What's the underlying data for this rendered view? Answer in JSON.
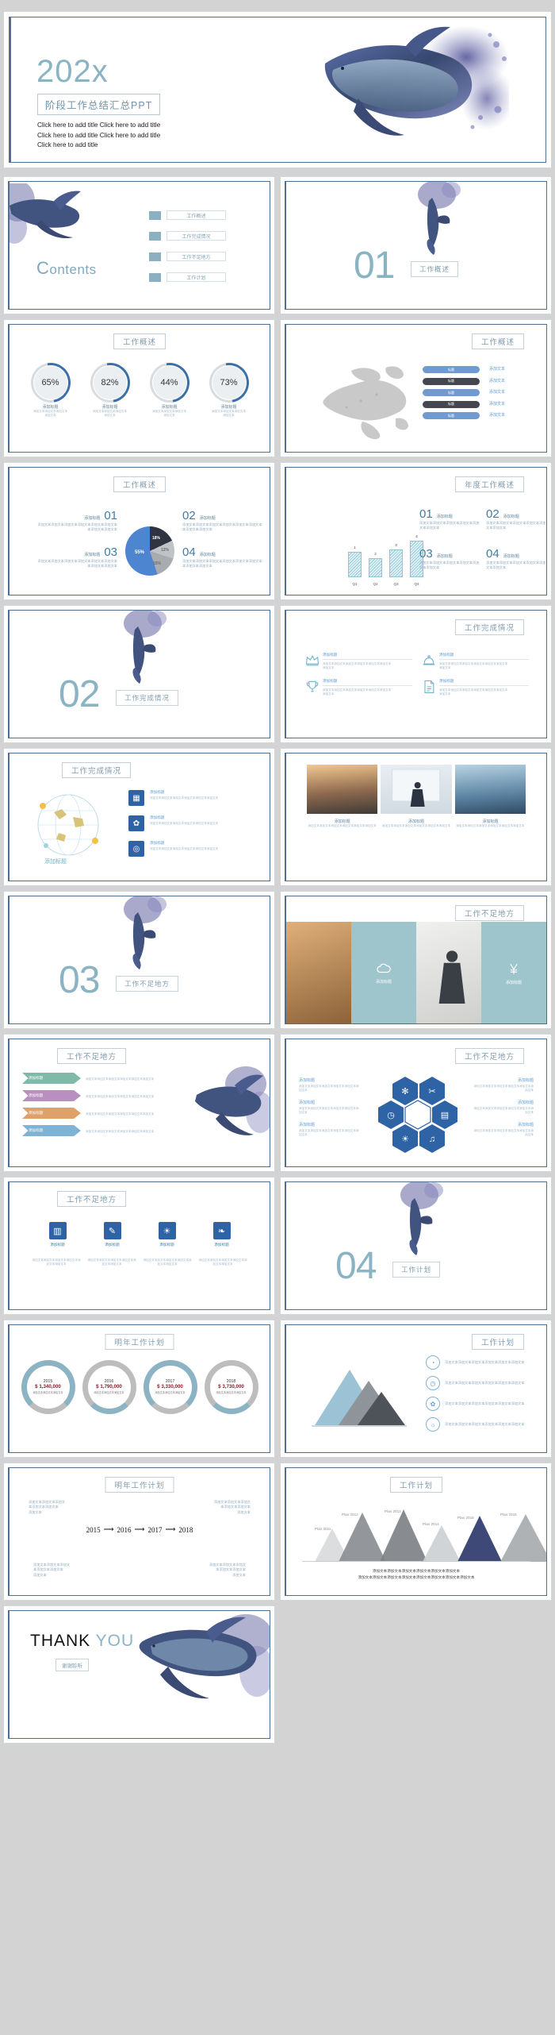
{
  "hero": {
    "year": "202x",
    "subtitle": "阶段工作总结汇总PPT",
    "line1": "Click here to add title Click here to add title",
    "line2": "Click here to add title Click here to add title",
    "line3": "Click here to add title"
  },
  "section_titles": {
    "overview": "工作概述",
    "annual_overview": "年度工作概述",
    "completion": "工作完成情况",
    "shortcomings": "工作不足地方",
    "plan": "工作计划",
    "next_year_plan": "明年工作计划",
    "thanks": "谢谢聆听"
  },
  "contents": {
    "heading_cap": "C",
    "heading_rest": "ontents",
    "items": [
      {
        "label": "工作概述"
      },
      {
        "label": "工作完成情况"
      },
      {
        "label": "工作不足地方"
      },
      {
        "label": "工作计划"
      }
    ]
  },
  "sections": [
    {
      "number": "01",
      "label": "工作概述"
    },
    {
      "number": "02",
      "label": "工作完成情况"
    },
    {
      "number": "03",
      "label": "工作不足地方"
    },
    {
      "number": "04",
      "label": "工作计划"
    }
  ],
  "placeholders": {
    "title": "添加标题",
    "text": "添加文本",
    "body_short": "添加文本添加文本添加文本",
    "body_long": "添加文本添加文本添加文本添加文本添加文本添加文本",
    "body_mid": "添加文本添加文本添加文",
    "body_tail": "本添加文本添加文本",
    "pill_label": "标题"
  },
  "chart_data": [
    {
      "type": "bar",
      "title": "工作概述",
      "subtype": "percent-rings",
      "categories": [
        "添加标题",
        "添加标题",
        "添加标题",
        "添加标题"
      ],
      "values": [
        65,
        82,
        44,
        73
      ],
      "labels": [
        "65%",
        "82%",
        "44%",
        "73%"
      ],
      "ylabel": "",
      "xlabel": "",
      "ylim": [
        0,
        100
      ]
    },
    {
      "type": "pie",
      "title": "工作概述",
      "categories": [
        "55%",
        "18%",
        "12%",
        "15%"
      ],
      "values": [
        55,
        18,
        12,
        15
      ],
      "labels": [
        "55%",
        "18%",
        "12%",
        "15%"
      ],
      "colors": [
        "#4d85d1",
        "#2f3342",
        "#bfc2c6",
        "#a8abaf"
      ],
      "legend": [
        "01 添加标题",
        "02 添加标题",
        "03 添加标题",
        "04 添加标题"
      ]
    },
    {
      "type": "bar",
      "title": "年度工作概述",
      "categories": [
        "Q1",
        "Q2",
        "Q3",
        "Q4"
      ],
      "values": [
        2,
        1.55,
        2.2,
        2.9
      ],
      "point_labels": [
        "1",
        "2",
        "3",
        "4"
      ],
      "legend": [
        "01 添加标题",
        "02 添加标题",
        "03 添加标题",
        "04 添加标题"
      ],
      "ylabel": "",
      "xlabel": ""
    },
    {
      "type": "bar",
      "title": "明年工作计划",
      "subtype": "donut-years",
      "categories": [
        "2015",
        "2016",
        "2017",
        "2018"
      ],
      "values": [
        1340000,
        1790000,
        3330000,
        3730000
      ],
      "labels": [
        "$ 1,340,000",
        "$ 1,790,000",
        "$ 3,330,000",
        "$ 3,730,000"
      ]
    },
    {
      "type": "area",
      "title": "工作计划",
      "subtype": "mountains",
      "categories": [
        "Plan 2011",
        "Plan 2012",
        "Plan 2013",
        "Plan 2014",
        "Plan 2015",
        "Plan 2016"
      ],
      "values": [
        38,
        62,
        66,
        44,
        58,
        60
      ],
      "highlight_index": 4,
      "caption_line1": "添加文本添加文本添加文本添加文本添加文本添加文本",
      "caption_line2": "添加文本添加文本添加文本添加文本添加文本添加文本添加文本添加文本"
    }
  ],
  "timeline": {
    "years": [
      "2015",
      "2016",
      "2017",
      "2018"
    ],
    "arrow": "⟶"
  },
  "thank_you": {
    "part1": "THANK",
    "part2": "YOU",
    "chip": "谢谢聆听"
  },
  "icons": {
    "crown": "crown-icon",
    "bell": "bell-icon",
    "trophy": "trophy-icon",
    "doc": "document-icon",
    "globe": "globe-icon",
    "chart": "chart-icon",
    "gear": "gear-icon",
    "clock": "clock-icon",
    "snow": "snowflake-icon",
    "cart": "cart-icon",
    "book": "book-icon",
    "brush": "brush-icon",
    "sun": "sun-icon",
    "leaf": "leaf-icon",
    "pie": "pie-icon",
    "target": "target-icon",
    "lightbulb": "lightbulb-icon",
    "whale": "whale-illustration",
    "map": "north-america-map"
  },
  "colors": {
    "accent": "#8ab4c4",
    "border": "#4d6f93",
    "blue": "#3c6fa8",
    "deep_blue": "#2e63a6",
    "navy": "#2f3a6b",
    "gray": "#bdbdbd",
    "money": "#8b1b2b"
  }
}
